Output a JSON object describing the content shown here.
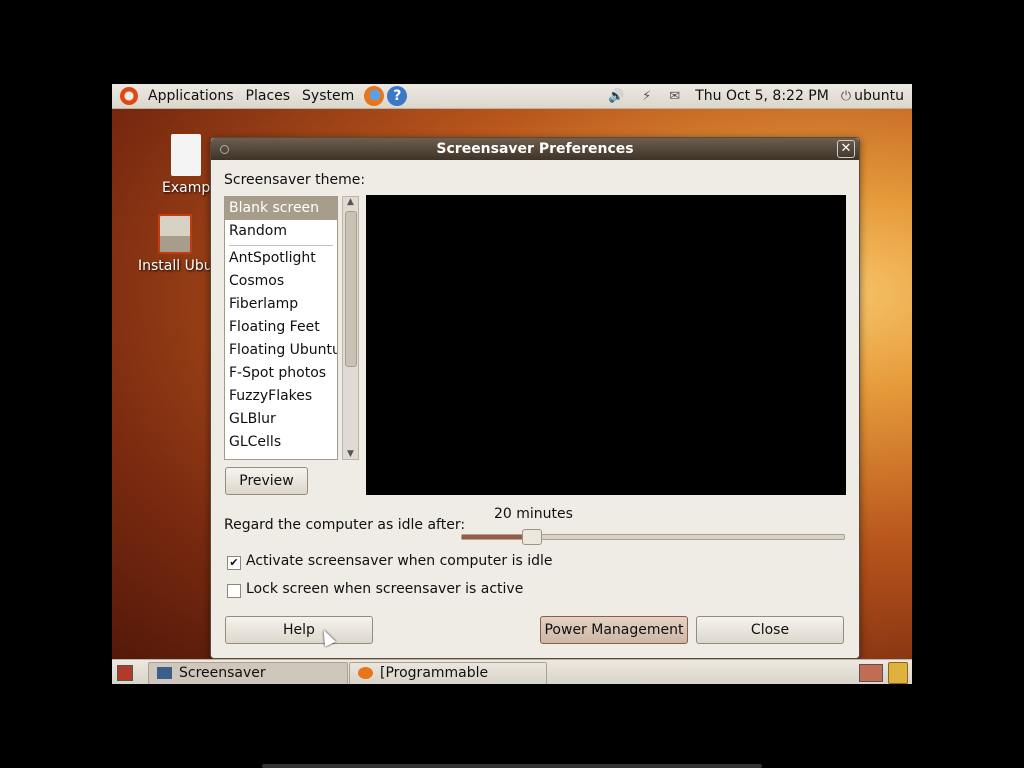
{
  "top_panel": {
    "menus": [
      "Applications",
      "Places",
      "System"
    ],
    "clock": "Thu Oct  5,  8:22 PM",
    "user": "ubuntu"
  },
  "desktop": {
    "icons": [
      "Examp",
      "Install Ubu"
    ]
  },
  "dialog": {
    "title": "Screensaver Preferences",
    "theme_label": "Screensaver theme:",
    "themes": [
      "Blank screen",
      "Random",
      "AntSpotlight",
      "Cosmos",
      "Fiberlamp",
      "Floating Feet",
      "Floating Ubuntu",
      "F-Spot photos",
      "FuzzyFlakes",
      "GLBlur",
      "GLCells"
    ],
    "selected_theme": "Blank screen",
    "preview_button": "Preview",
    "idle_label": "Regard the computer as idle after:",
    "idle_value_text": "20 minutes",
    "idle_slider_fraction": 0.18,
    "activate_label": "Activate screensaver when computer is idle",
    "activate_checked": true,
    "lock_label": "Lock screen when screensaver is active",
    "lock_checked": false,
    "help_button": "Help",
    "power_button": "Power Management",
    "close_button": "Close"
  },
  "taskbar": {
    "tasks": [
      "Screensaver Preferences",
      "[Programmable Search..."
    ]
  },
  "colors": {
    "title_bar": "#3e3328",
    "selection": "#a89c8b",
    "accent": "#dd4814"
  }
}
